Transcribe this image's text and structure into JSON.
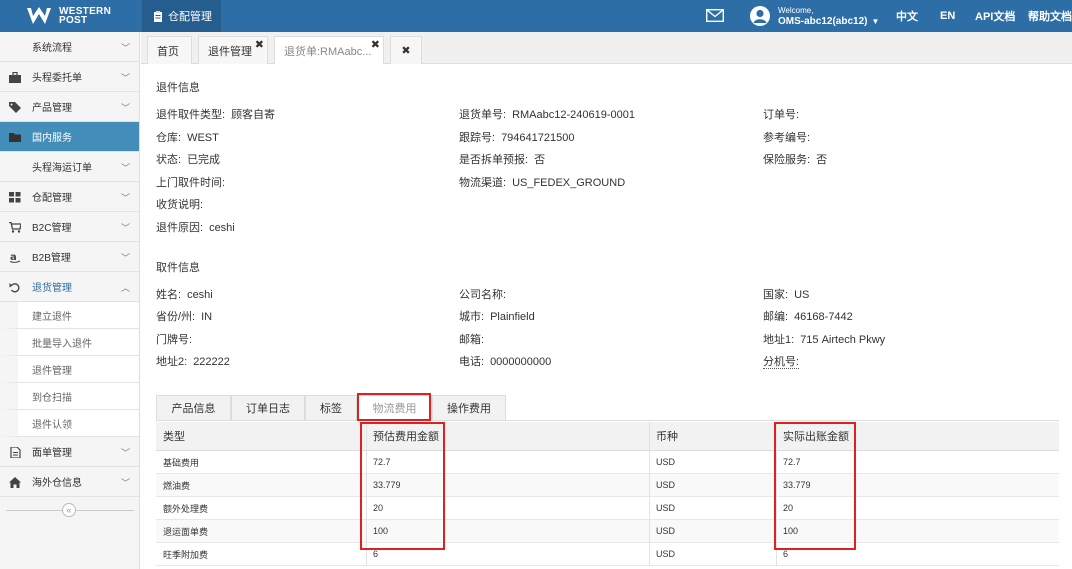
{
  "brand": {
    "line1": "WESTERN",
    "line2": "POST"
  },
  "topbar": {
    "module_tab": "仓配管理",
    "welcome": "Welcome,",
    "username": "OMS-abc12(abc12)",
    "lang_cn": "中文",
    "lang_en": "EN",
    "api_doc": "API文档",
    "help_doc": "帮助文档"
  },
  "sidebar": {
    "items": [
      {
        "label": "系统流程",
        "icon": "none"
      },
      {
        "label": "头程委托单",
        "icon": "briefcase-icon"
      },
      {
        "label": "产品管理",
        "icon": "tag-icon"
      },
      {
        "label": "国内服务",
        "icon": "folder-icon"
      },
      {
        "label": "头程海运订单",
        "icon": "none"
      },
      {
        "label": "仓配管理",
        "icon": "grid-icon"
      },
      {
        "label": "B2C管理",
        "icon": "cart-icon"
      },
      {
        "label": "B2B管理",
        "icon": "amazon-icon"
      },
      {
        "label": "退货管理",
        "icon": "undo-icon"
      }
    ],
    "sub_items": [
      "建立退件",
      "批量导入退件",
      "退件管理",
      "到仓扫描",
      "退件认领"
    ],
    "bottom_items": [
      {
        "label": "面单管理",
        "icon": "document-icon"
      },
      {
        "label": "海外仓信息",
        "icon": "home-icon"
      }
    ]
  },
  "page_tabs": {
    "home": "首页",
    "returns": "退件管理",
    "detail": "退货单:RMAabc..."
  },
  "return_info": {
    "title": "退件信息",
    "pickup_type_label": "退件取件类型:",
    "pickup_type": "顾客自寄",
    "rma_label": "退货单号:",
    "rma": "RMAabc12-240619-0001",
    "order_label": "订单号:",
    "order": "",
    "warehouse_label": "仓库:",
    "warehouse": "WEST",
    "tracking_label": "跟踪号:",
    "tracking": "794641721500",
    "ref_label": "参考编号:",
    "ref": "",
    "status_label": "状态:",
    "status": "已完成",
    "split_label": "是否拆单预报:",
    "split": "否",
    "insurance_label": "保险服务:",
    "insurance": "否",
    "pickup_time_label": "上门取件时间:",
    "pickup_time": "",
    "channel_label": "物流渠道:",
    "channel": "US_FEDEX_GROUND",
    "receipt_note_label": "收货说明:",
    "receipt_note": "",
    "reason_label": "退件原因:",
    "reason": "ceshi"
  },
  "pickup_info": {
    "title": "取件信息",
    "name_label": "姓名:",
    "name": "ceshi",
    "company_label": "公司名称:",
    "company": "",
    "country_label": "国家:",
    "country": "US",
    "state_label": "省份/州:",
    "state": "IN",
    "city_label": "城市:",
    "city": "Plainfield",
    "zip_label": "邮编:",
    "zip": "46168-7442",
    "door_label": "门牌号:",
    "door": "",
    "email_label": "邮箱:",
    "email": "",
    "addr1_label": "地址1:",
    "addr1": "715 Airtech Pkwy",
    "addr2_label": "地址2:",
    "addr2": "222222",
    "phone_label": "电话:",
    "phone": "0000000000",
    "ext_label": "分机号:",
    "ext": ""
  },
  "inner_tabs": [
    "产品信息",
    "订单日志",
    "标签",
    "物流费用",
    "操作费用"
  ],
  "fee_table": {
    "headers": [
      "类型",
      "预估费用金额",
      "币种",
      "实际出账金额"
    ],
    "rows": [
      [
        "基础费用",
        "72.7",
        "USD",
        "72.7"
      ],
      [
        "燃油费",
        "33.779",
        "USD",
        "33.779"
      ],
      [
        "额外处理费",
        "20",
        "USD",
        "20"
      ],
      [
        "退运面单费",
        "100",
        "USD",
        "100"
      ],
      [
        "旺季附加费",
        "6",
        "USD",
        "6"
      ]
    ]
  },
  "colors": {
    "topbar": "#2e6ea6",
    "active_nav": "#438eb9",
    "highlight": "#e02020"
  }
}
